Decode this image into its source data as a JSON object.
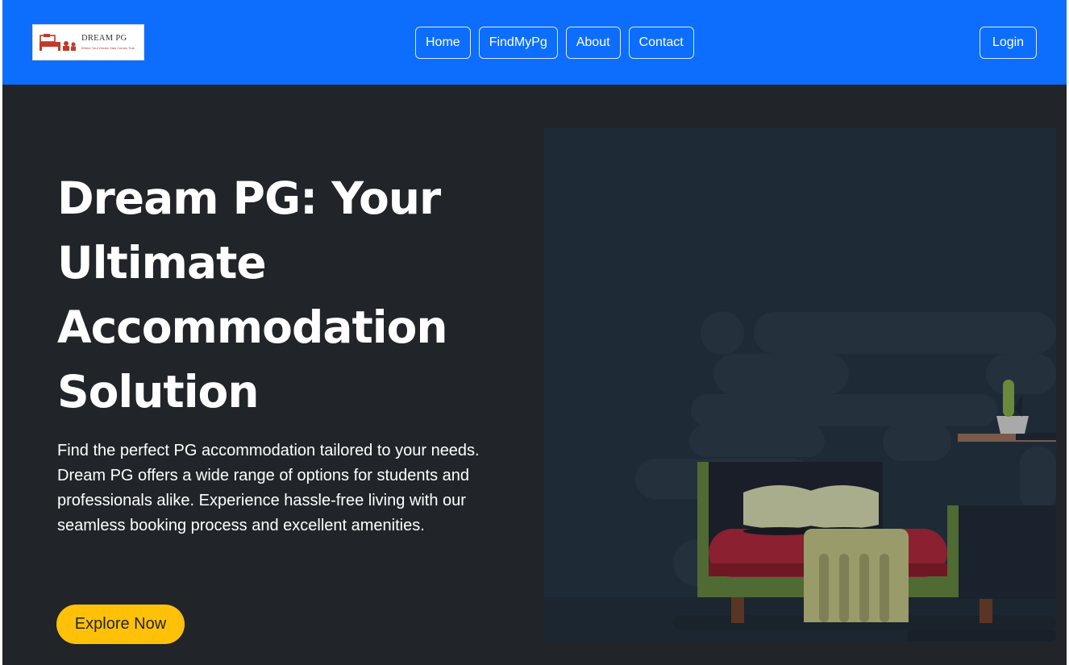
{
  "brand": {
    "name": "DREAM PG",
    "tagline": "Where Your Dream Stay Comes True"
  },
  "nav": {
    "links": [
      "Home",
      "FindMyPg",
      "About",
      "Contact"
    ],
    "login_label": "Login"
  },
  "hero": {
    "title": "Dream PG: Your Ultimate Accommodation Solution",
    "description": "Find the perfect PG accommodation tailored to your needs. Dream PG offers a wide range of options for students and professionals alike. Experience hassle-free living with our seamless booking process and excellent amenities.",
    "cta_label": "Explore Now"
  },
  "illustration": {
    "icon": "bedroom-illustration"
  },
  "colors": {
    "navbar": "#0d6efd",
    "background": "#212529",
    "cta": "#ffc107",
    "illustration_bg": "#1e2b36"
  }
}
